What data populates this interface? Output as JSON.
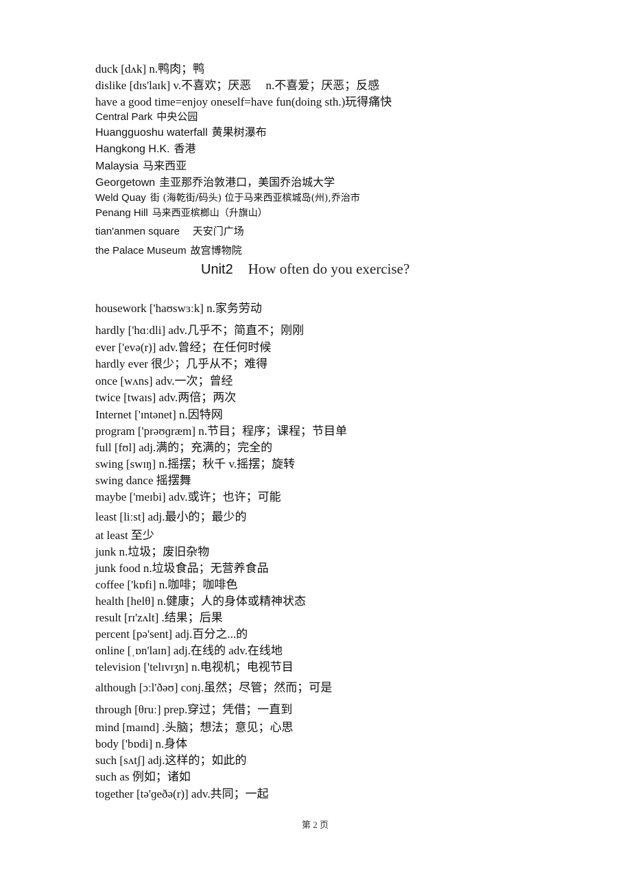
{
  "page": {
    "section1": [
      {
        "text": "duck [dʌk] n.鸭肉；鸭"
      },
      {
        "text": "dislike [dɪs'laɪk] v.不喜欢；厌恶　 n.不喜爱；厌恶；反感"
      },
      {
        "text": "have a good time=enjoy oneself=have fun(doing sth.)玩得痛快"
      }
    ],
    "places": [
      {
        "en": "Central Park",
        "cn": "中央公园"
      },
      {
        "en": "Huangguoshu waterfall",
        "cn": "黄果树瀑布"
      },
      {
        "en": "Hangkong H.K.",
        "cn": "香港"
      },
      {
        "en": "Malaysia",
        "cn": "马来西亚"
      },
      {
        "en": "Georgetown",
        "cn": "圭亚那乔治敦港口，美国乔治城大学"
      },
      {
        "en": "Weld Quay",
        "cn": "街  (海乾街/码头)  位于马来西亚槟城岛(州),乔治市"
      },
      {
        "en": "Penang Hill",
        "cn": "马来西亚槟榔山（升旗山）"
      },
      {
        "en": "tian'anmen square",
        "cn": "  天安门广场"
      },
      {
        "en": "the Palace Museum",
        "cn": "故宫博物院"
      }
    ],
    "unit_title": {
      "unit": "Unit2",
      "question": "How often do you exercise?"
    },
    "vocab": [
      "housework ['haʊswɜːk] n.家务劳动",
      "hardly ['hɑːdli] adv.几乎不；简直不；刚刚",
      "ever ['evə(r)] adv.曾经；在任何时候",
      "hardly ever 很少；几乎从不；难得",
      "once [wʌns] adv.一次；曾经",
      "twice [twaɪs] adv.两倍；两次",
      "Internet ['ɪntənet] n.因特网",
      "program ['prəʊɡræm] n.节目；程序；课程；节目单",
      "full [fʊl] adj.满的；充满的；完全的",
      "swing [swɪŋ] n.摇摆；秋千 v.摇摆；旋转",
      "swing dance 摇摆舞",
      "maybe ['meɪbi] adv.或许；也许；可能",
      "least [liːst] adj.最小的；最少的",
      "at least 至少",
      "junk n.垃圾；废旧杂物",
      "junk food n.垃圾食品；无营养食品",
      "coffee ['kɒfi] n.咖啡；咖啡色",
      "health [helθ] n.健康；人的身体或精神状态",
      "result [rɪ'zʌlt] .结果；后果",
      "percent [pə'sent] adj.百分之...的",
      "online [ˌɒn'laɪn] adj.在线的 adv.在线地",
      "television ['telɪvɪʒn] n.电视机；电视节目",
      "although [ɔːl'ðəʊ] conj.虽然；尽管；然而；可是",
      "through [θruː] prep.穿过；凭借；一直到",
      "mind [maɪnd] .头脑；想法；意见；心思",
      "body ['bɒdi] n.身体",
      "such [sʌtʃ] adj.这样的；如此的",
      "such as 例如；诸如",
      "together [tə'ɡeðə(r)] adv.共同；一起"
    ],
    "footer": "第 2 页"
  }
}
